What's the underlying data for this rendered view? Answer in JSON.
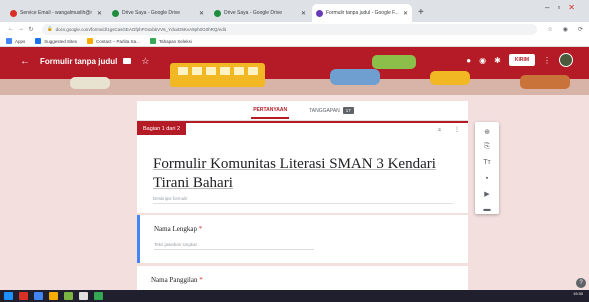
{
  "browser": {
    "tabs": [
      {
        "title": "Service Email - wangalmuslih@r",
        "favicon_color": "#d93025",
        "active": false
      },
      {
        "title": "Drive Saya - Google Drive",
        "favicon_color": "#1e8e3e",
        "active": false
      },
      {
        "title": "Drive Saya - Google Drive",
        "favicon_color": "#1e8e3e",
        "active": false
      },
      {
        "title": "Formulir tanpa judul - Google F...",
        "favicon_color": "#673ab7",
        "active": true
      }
    ],
    "new_tab": "+",
    "url": "docs.google.com/forms/d/1gsCasGEAGfphFGsxbkVV6_YdxxD5KvA9ph0G0hRQ/edit",
    "bookmarks": [
      {
        "label": "Apps",
        "color": "#4285f4"
      },
      {
        "label": "Suggested Sites",
        "color": "#1a73e8"
      },
      {
        "label": "Contact – Parlita Sa...",
        "color": "#f9ab00"
      },
      {
        "label": "Tahapan Seleksi",
        "color": "#34a853"
      }
    ]
  },
  "form_header": {
    "title": "Formulir tanpa judul",
    "send_label": "KIRIM",
    "accent": "#b51b26"
  },
  "tabs": {
    "questions": "PERTANYAAN",
    "responses": "TANGGAPAN",
    "responses_count": "17"
  },
  "section": {
    "label": "Bagian 1 dari 2",
    "form_title": "Formulir Komunitas Literasi SMAN 3 Kendari Tirani Bahari",
    "description_placeholder": "Deskripsi formulir"
  },
  "questions": [
    {
      "title": "Nama Lengkap",
      "required_mark": "*",
      "hint": "Teks jawaban singkat"
    },
    {
      "title": "Nama Panggilan",
      "required_mark": "*"
    }
  ],
  "sidebar_tools": [
    "add-question-icon",
    "import-question-icon",
    "title-text-icon",
    "image-icon",
    "video-icon",
    "section-icon"
  ],
  "help": "?",
  "taskbar": {
    "time": "19:30"
  }
}
